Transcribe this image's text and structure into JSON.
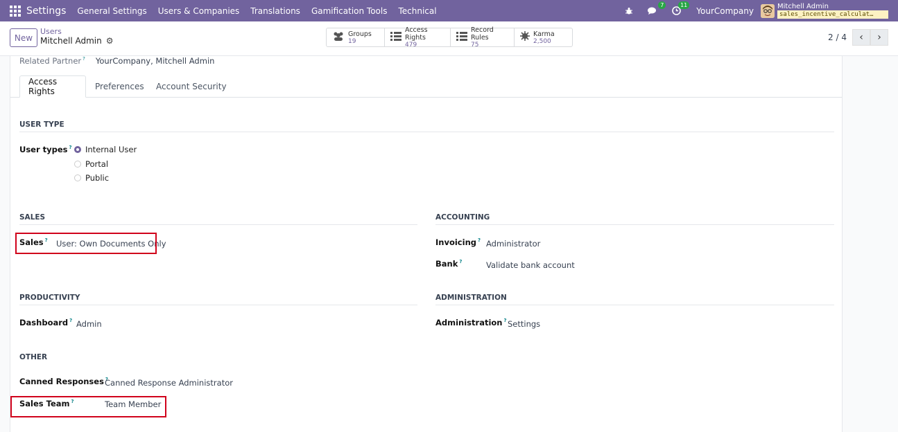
{
  "navbar": {
    "app_name": "Settings",
    "menu": [
      "General Settings",
      "Users & Companies",
      "Translations",
      "Gamification Tools",
      "Technical"
    ],
    "messages_badge": "7",
    "activities_badge": "11",
    "company": "YourCompany",
    "user_name": "Mitchell Admin",
    "database": "sales_incentive_calculat…"
  },
  "control": {
    "new_label": "New",
    "breadcrumb_parent": "Users",
    "breadcrumb_current": "Mitchell Admin",
    "stats": [
      {
        "label": "Groups",
        "value": "19",
        "icon": "groups-icon"
      },
      {
        "label": "Access Rights",
        "value": "479",
        "icon": "list-icon"
      },
      {
        "label": "Record Rules",
        "value": "75",
        "icon": "list-icon"
      },
      {
        "label": "Karma",
        "value": "2,500",
        "icon": "karma-icon"
      }
    ],
    "pager": "2 / 4"
  },
  "form": {
    "related_partner_label": "Related Partner",
    "related_partner_value": "YourCompany, Mitchell Admin",
    "tabs": [
      "Access Rights",
      "Preferences",
      "Account Security"
    ],
    "user_type": {
      "title": "USER TYPE",
      "label": "User types",
      "options": [
        "Internal User",
        "Portal",
        "Public"
      ]
    },
    "sales": {
      "title": "SALES",
      "label": "Sales",
      "value": "User: Own Documents Only"
    },
    "accounting": {
      "title": "ACCOUNTING",
      "invoicing_label": "Invoicing",
      "invoicing_value": "Administrator",
      "bank_label": "Bank",
      "bank_value": "Validate bank account"
    },
    "productivity": {
      "title": "PRODUCTIVITY",
      "label": "Dashboard",
      "value": "Admin"
    },
    "administration": {
      "title": "ADMINISTRATION",
      "label": "Administration",
      "value": "Settings"
    },
    "other": {
      "title": "OTHER",
      "canned_label": "Canned Responses",
      "canned_value": "Canned Response Administrator",
      "team_label": "Sales Team",
      "team_value": "Team Member"
    }
  }
}
